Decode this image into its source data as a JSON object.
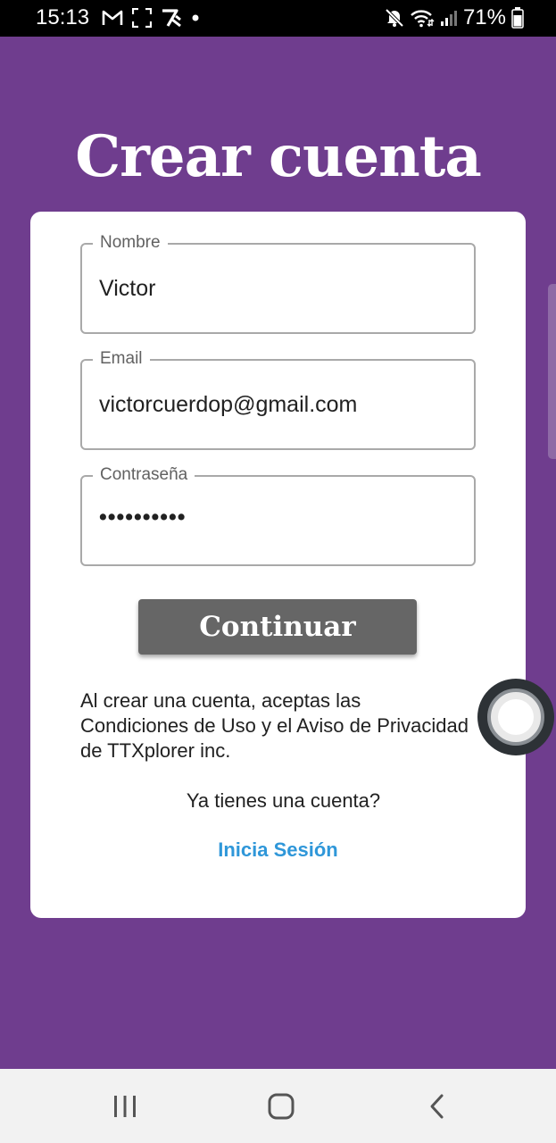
{
  "status_bar": {
    "time": "15:13",
    "left_icons": [
      "gmail-icon",
      "screenshot-icon",
      "app-notification-icon",
      "dot-icon"
    ],
    "right_icons": [
      "mute-icon",
      "wifi-icon",
      "signal-icon",
      "battery-icon"
    ],
    "battery": "71%"
  },
  "header": {
    "title": "Crear cuenta"
  },
  "form": {
    "name": {
      "label": "Nombre",
      "value": "Victor"
    },
    "email": {
      "label": "Email",
      "value": "victorcuerdop@gmail.com"
    },
    "password": {
      "label": "Contraseña",
      "value": "••••••••••"
    },
    "continue_label": "Continuar"
  },
  "footer": {
    "terms": "Al crear una cuenta, aceptas las Condiciones de Uso y el Aviso de Privacidad de TTXplorer inc.",
    "have_account": "Ya tienes una cuenta?",
    "login_link": "Inicia Sesión"
  },
  "nav": {
    "buttons": [
      "recent-apps-icon",
      "home-icon",
      "back-icon"
    ]
  },
  "colors": {
    "background": "#6f3d8e",
    "card": "#ffffff",
    "button": "#666666",
    "link": "#2f97d9"
  }
}
